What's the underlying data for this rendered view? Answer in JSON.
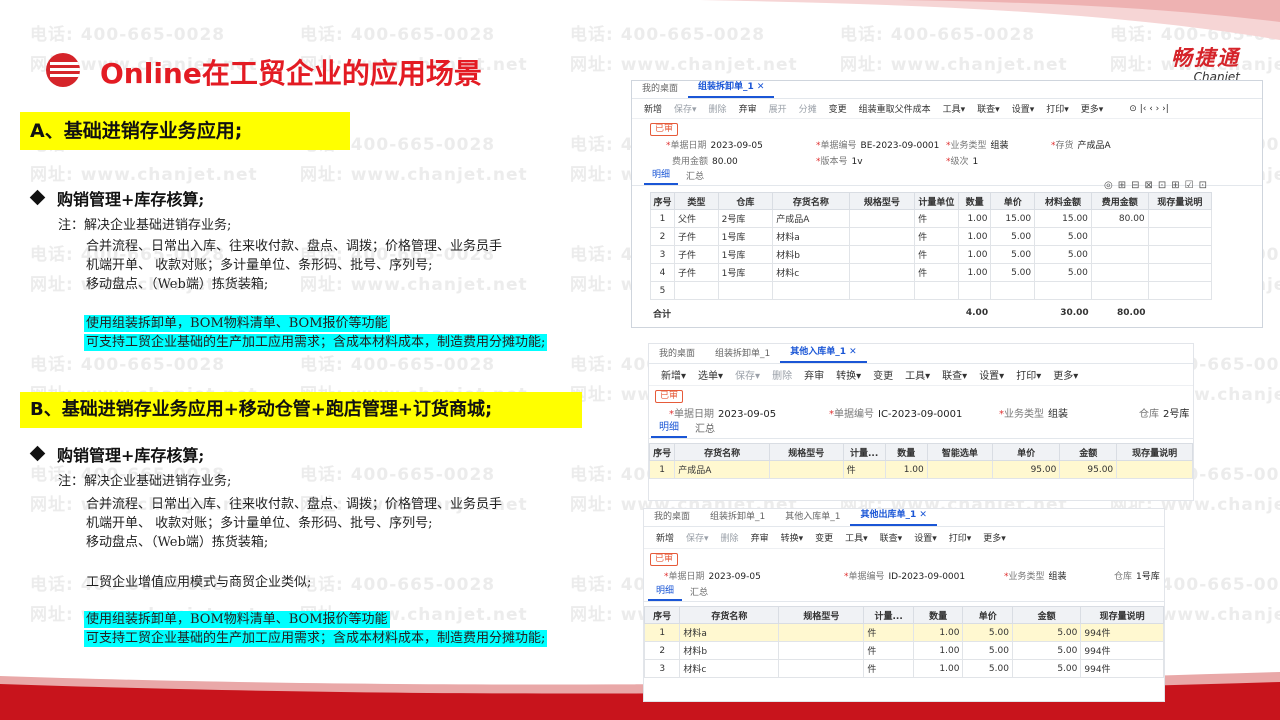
{
  "watermark": {
    "phone": "电话: 400-665-0028",
    "site": "网址: www.chanjet.net"
  },
  "header": {
    "title": "Online在工贸企业的应用场景",
    "brand_cn": "畅捷通",
    "brand_en": "Chanjet"
  },
  "colors": {
    "accent_red": "#e31b23",
    "highlight_yellow": "#ffff00",
    "highlight_cyan": "#00ffff",
    "link_blue": "#1a56d6"
  },
  "section_a": {
    "heading": "A、基础进销存业务应用;",
    "bullet": "购销管理+库存核算;",
    "note": "注：解决企业基础进销存业务;",
    "line1": "合并流程、日常出入库、往来收付款、盘点、调拨；价格管理、业务员手",
    "line2": "机端开单、  收款对账；多计量单位、条形码、批号、序列号;",
    "line3": "移动盘点、（Web端）拣货装箱;",
    "hl1": "使用组装拆卸单，BOM物料清单、BOM报价等功能",
    "hl2": "可支持工贸企业基础的生产加工应用需求；含成本材料成本，制造费用分摊功能;"
  },
  "section_b": {
    "heading": "B、基础进销存业务应用+移动仓管+跑店管理+订货商城;",
    "bullet": "购销管理+库存核算;",
    "note": "注：解决企业基础进销存业务;",
    "line1": "合并流程、日常出入库、往来收付款、盘点、调拨；价格管理、业务员手",
    "line2": "机端开单、  收款对账；多计量单位、条形码、批号、序列号;",
    "line3": "移动盘点、（Web端）拣货装箱;",
    "line4": "工贸企业增值应用模式与商贸企业类似;",
    "hl1": "使用组装拆卸单，BOM物料清单、BOM报价等功能",
    "hl2": "可支持工贸企业基础的生产加工应用需求；含成本材料成本，制造费用分摊功能;"
  },
  "shot1": {
    "tabs": [
      "我的桌面",
      "组装拆卸单_1"
    ],
    "toolbar": [
      "新增",
      "保存▾",
      "删除",
      "弃审",
      "展开",
      "分摊",
      "变更",
      "组装重取父件成本",
      "工具▾",
      "联查▾",
      "设置▾",
      "打印▾",
      "更多▾"
    ],
    "status": "已审",
    "f_date_l": "单据日期",
    "f_date_v": "2023-09-05",
    "f_no_l": "单据编号",
    "f_no_v": "BE-2023-09-0001",
    "f_type_l": "业务类型",
    "f_type_v": "组装",
    "f_inv_l": "存货",
    "f_inv_v": "产成品A",
    "f_fee_l": "费用金额",
    "f_fee_v": "80.00",
    "f_ver_l": "版本号",
    "f_ver_v": "1v",
    "f_lvl_l": "级次",
    "f_lvl_v": "1",
    "subtabs": [
      "明细",
      "汇总"
    ],
    "columns": [
      "序号",
      "类型",
      "仓库",
      "存货名称",
      "规格型号",
      "计量单位",
      "数量",
      "单价",
      "材料金额",
      "费用金额",
      "现存量说明"
    ],
    "rows": [
      [
        "1",
        "父件",
        "2号库",
        "产成品A",
        "",
        "件",
        "1.00",
        "15.00",
        "15.00",
        "80.00",
        ""
      ],
      [
        "2",
        "子件",
        "1号库",
        "材料a",
        "",
        "件",
        "1.00",
        "5.00",
        "5.00",
        "",
        ""
      ],
      [
        "3",
        "子件",
        "1号库",
        "材料b",
        "",
        "件",
        "1.00",
        "5.00",
        "5.00",
        "",
        ""
      ],
      [
        "4",
        "子件",
        "1号库",
        "材料c",
        "",
        "件",
        "1.00",
        "5.00",
        "5.00",
        "",
        ""
      ],
      [
        "5",
        "",
        "",
        "",
        "",
        "",
        "",
        "",
        "",
        "",
        ""
      ]
    ],
    "total_label": "合计",
    "total_qty": "4.00",
    "total_mat": "30.00",
    "total_fee": "80.00"
  },
  "shot2": {
    "tabs": [
      "我的桌面",
      "组装拆卸单_1",
      "其他入库单_1"
    ],
    "toolbar": [
      "新增▾",
      "选单▾",
      "保存▾",
      "删除",
      "弃审",
      "转换▾",
      "变更",
      "工具▾",
      "联查▾",
      "设置▾",
      "打印▾",
      "更多▾"
    ],
    "status": "已审",
    "f_date_l": "单据日期",
    "f_date_v": "2023-09-05",
    "f_no_l": "单据编号",
    "f_no_v": "IC-2023-09-0001",
    "f_type_l": "业务类型",
    "f_type_v": "组装",
    "f_wh_l": "仓库",
    "f_wh_v": "2号库",
    "subtabs": [
      "明细",
      "汇总"
    ],
    "columns": [
      "序号",
      "存货名称",
      "规格型号",
      "计量...",
      "数量",
      "智能选单",
      "单价",
      "金额",
      "现存量说明"
    ],
    "rows": [
      [
        "1",
        "产成品A",
        "",
        "件",
        "1.00",
        "",
        "95.00",
        "95.00",
        ""
      ]
    ]
  },
  "shot3": {
    "tabs": [
      "我的桌面",
      "组装拆卸单_1",
      "其他入库单_1",
      "其他出库单_1"
    ],
    "toolbar": [
      "新增",
      "保存▾",
      "删除",
      "弃审",
      "转换▾",
      "变更",
      "工具▾",
      "联查▾",
      "设置▾",
      "打印▾",
      "更多▾"
    ],
    "status": "已审",
    "f_date_l": "单据日期",
    "f_date_v": "2023-09-05",
    "f_no_l": "单据编号",
    "f_no_v": "ID-2023-09-0001",
    "f_type_l": "业务类型",
    "f_type_v": "组装",
    "f_wh_l": "仓库",
    "f_wh_v": "1号库",
    "subtabs": [
      "明细",
      "汇总"
    ],
    "columns": [
      "序号",
      "存货名称",
      "规格型号",
      "计量...",
      "数量",
      "单价",
      "金额",
      "现存量说明"
    ],
    "rows": [
      [
        "1",
        "材料a",
        "",
        "件",
        "1.00",
        "5.00",
        "5.00",
        "994件"
      ],
      [
        "2",
        "材料b",
        "",
        "件",
        "1.00",
        "5.00",
        "5.00",
        "994件"
      ],
      [
        "3",
        "材料c",
        "",
        "件",
        "1.00",
        "5.00",
        "5.00",
        "994件"
      ]
    ]
  }
}
